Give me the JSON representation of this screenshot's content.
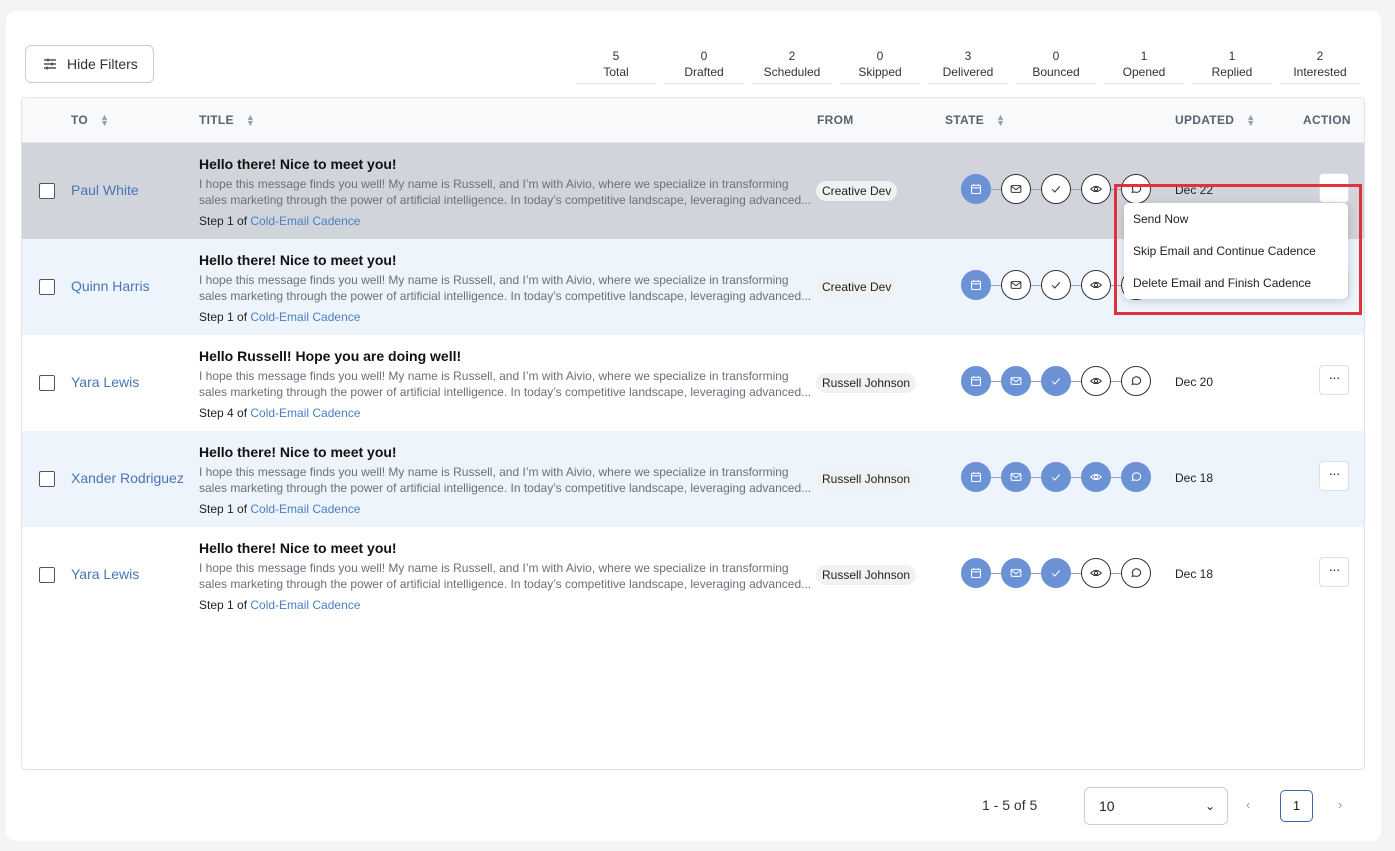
{
  "filters": {
    "hide_label": "Hide Filters"
  },
  "stats": [
    {
      "count": "5",
      "label": "Total"
    },
    {
      "count": "0",
      "label": "Drafted"
    },
    {
      "count": "2",
      "label": "Scheduled"
    },
    {
      "count": "0",
      "label": "Skipped"
    },
    {
      "count": "3",
      "label": "Delivered"
    },
    {
      "count": "0",
      "label": "Bounced"
    },
    {
      "count": "1",
      "label": "Opened"
    },
    {
      "count": "1",
      "label": "Replied"
    },
    {
      "count": "2",
      "label": "Interested"
    }
  ],
  "columns": {
    "to": "TO",
    "title": "TITLE",
    "from": "FROM",
    "state": "STATE",
    "updated": "UPDATED",
    "action": "ACTION"
  },
  "rows": [
    {
      "to": "Paul White",
      "title": "Hello there! Nice to meet you!",
      "body1": "I hope this message finds you well! My name is Russell, and I’m with Aivio, where we specialize in transforming",
      "body2": "sales marketing through the power of artificial intelligence. In today’s competitive landscape, leveraging advanced...",
      "step": "Step 1 of ",
      "cadence": "Cold-Email Cadence",
      "from": "Creative Dev",
      "states": [
        "on",
        "off",
        "off",
        "off",
        "off"
      ],
      "updated": "Dec 22"
    },
    {
      "to": "Quinn Harris",
      "title": "Hello there! Nice to meet you!",
      "body1": "I hope this message finds you well! My name is Russell, and I’m with Aivio, where we specialize in transforming",
      "body2": "sales marketing through the power of artificial intelligence. In today’s competitive landscape, leveraging advanced...",
      "step": "Step 1 of ",
      "cadence": "Cold-Email Cadence",
      "from": "Creative Dev",
      "states": [
        "on",
        "off",
        "off",
        "off",
        "off"
      ],
      "updated": ""
    },
    {
      "to": "Yara Lewis",
      "title": "Hello Russell! Hope you are doing well!",
      "body1": "I hope this message finds you well! My name is Russell, and I’m with Aivio, where we specialize in transforming",
      "body2": "sales marketing through the power of artificial intelligence. In today’s competitive landscape, leveraging advanced...",
      "step": "Step 4 of ",
      "cadence": "Cold-Email Cadence",
      "from": "Russell Johnson",
      "states": [
        "on",
        "on",
        "on",
        "off",
        "off"
      ],
      "updated": "Dec 20"
    },
    {
      "to": "Xander Rodriguez",
      "title": "Hello there! Nice to meet you!",
      "body1": "I hope this message finds you well! My name is Russell, and I’m with Aivio, where we specialize in transforming",
      "body2": "sales marketing through the power of artificial intelligence. In today’s competitive landscape, leveraging advanced...",
      "step": "Step 1 of ",
      "cadence": "Cold-Email Cadence",
      "from": "Russell Johnson",
      "states": [
        "on",
        "on",
        "on",
        "on",
        "on"
      ],
      "updated": "Dec 18"
    },
    {
      "to": "Yara Lewis",
      "title": "Hello there! Nice to meet you!",
      "body1": "I hope this message finds you well! My name is Russell, and I’m with Aivio, where we specialize in transforming",
      "body2": "sales marketing through the power of artificial intelligence. In today’s competitive landscape, leveraging advanced...",
      "step": "Step 1 of ",
      "cadence": "Cold-Email Cadence",
      "from": "Russell Johnson",
      "states": [
        "on",
        "on",
        "on",
        "off",
        "off"
      ],
      "updated": "Dec 18"
    }
  ],
  "state_icons": [
    "calendar-icon",
    "mail-icon",
    "check-icon",
    "eye-icon",
    "chat-icon"
  ],
  "action_menu": {
    "items": [
      "Send Now",
      "Skip Email and Continue Cadence",
      "Delete Email and Finish Cadence"
    ]
  },
  "pagination": {
    "range": "1 - 5 of 5",
    "page_size": "10",
    "current_page": "1"
  },
  "colors": {
    "accent": "#6a92d4",
    "link": "#4a74b8",
    "highlight": "#e0323a",
    "selected_row": "#d1d5db",
    "alt_row": "#eef4fc"
  }
}
